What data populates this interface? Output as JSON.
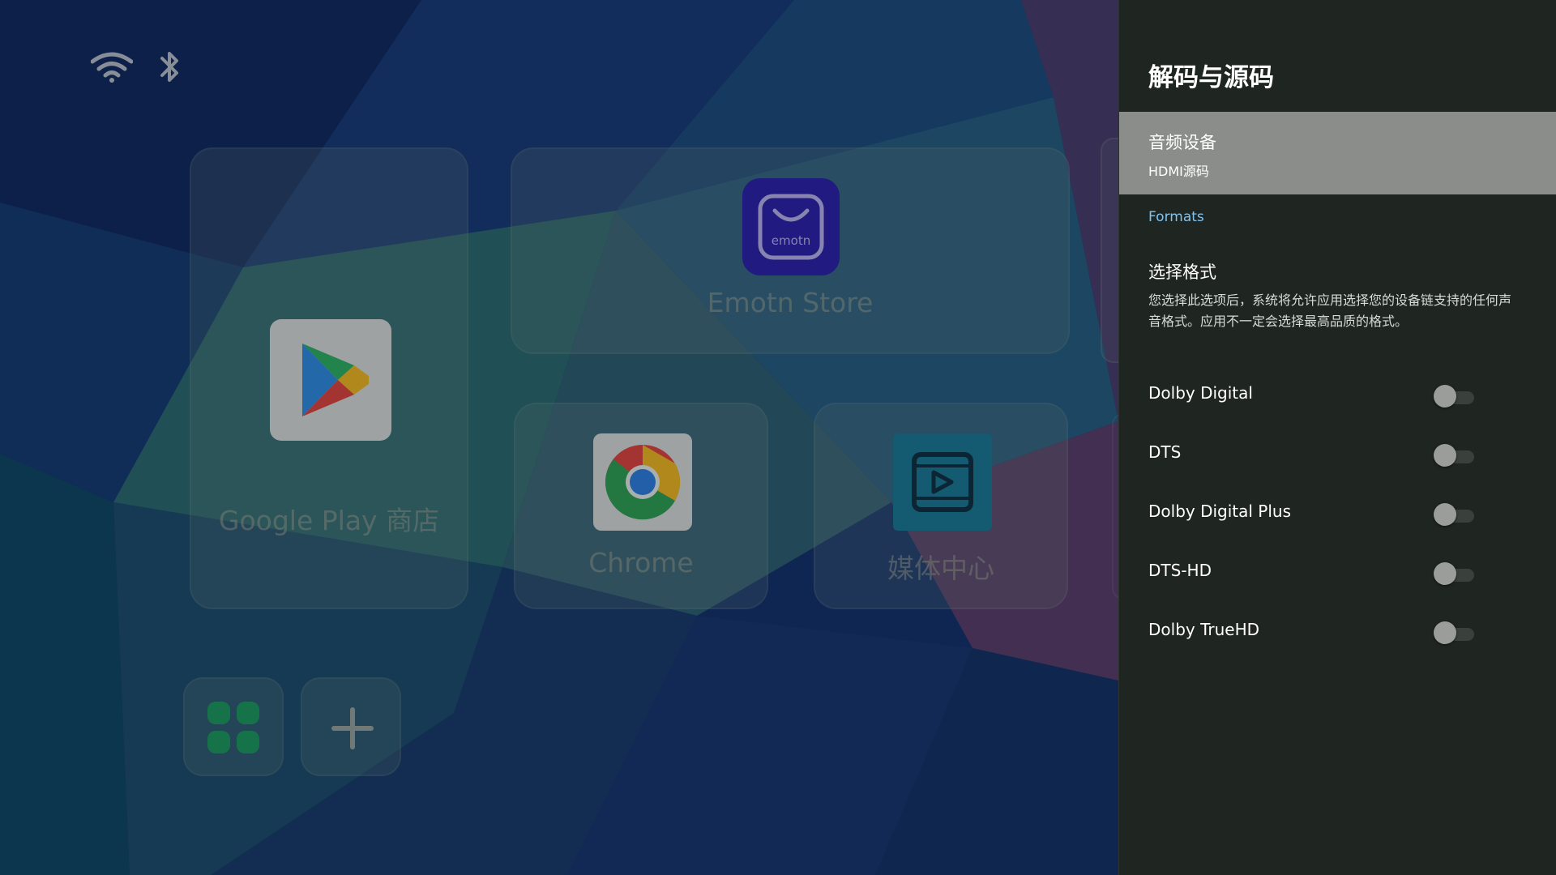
{
  "launcher": {
    "status_icons": [
      "wifi-icon",
      "bluetooth-icon"
    ],
    "apps": [
      {
        "id": "play",
        "label": "Google Play 商店",
        "icon": "google-play-icon"
      },
      {
        "id": "emotn",
        "label": "Emotn Store",
        "icon": "emotn-store-icon",
        "icon_text": "emotn"
      },
      {
        "id": "chrome",
        "label": "Chrome",
        "icon": "chrome-icon"
      },
      {
        "id": "media",
        "label": "媒体中心",
        "icon": "media-center-icon"
      }
    ],
    "shortcuts": [
      {
        "id": "apps",
        "icon": "apps-grid-icon"
      },
      {
        "id": "add",
        "icon": "plus-icon"
      }
    ]
  },
  "panel": {
    "title": "解码与源码",
    "audio_device": {
      "title": "音频设备",
      "subtitle": "HDMI源码"
    },
    "section_header": "Formats",
    "format_select": {
      "title": "选择格式",
      "description": "您选择此选项后，系统将允许应用选择您的设备链支持的任何声音格式。应用不一定会选择最高品质的格式。"
    },
    "toggles": [
      {
        "label": "Dolby Digital",
        "on": false
      },
      {
        "label": "DTS",
        "on": false
      },
      {
        "label": "Dolby Digital Plus",
        "on": false
      },
      {
        "label": "DTS-HD",
        "on": false
      },
      {
        "label": "Dolby TrueHD",
        "on": false
      }
    ]
  },
  "colors": {
    "panel_bg": "#1f2520",
    "selected_bg": "#8b8d8b",
    "accent": "#7fc3f0"
  }
}
